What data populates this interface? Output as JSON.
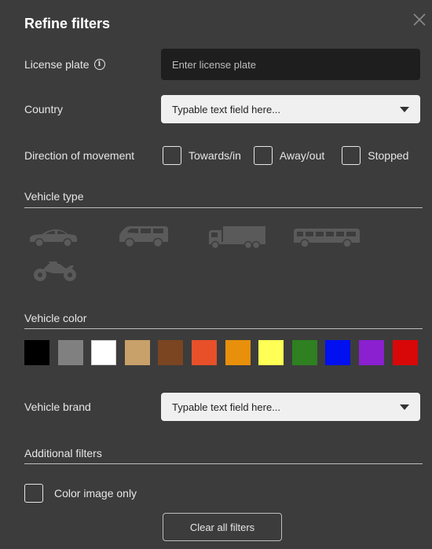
{
  "title": "Refine filters",
  "license_plate": {
    "label": "License plate",
    "placeholder": "Enter license plate"
  },
  "country": {
    "label": "Country",
    "value": "Typable text field here..."
  },
  "direction": {
    "label": "Direction of movement",
    "options": [
      "Towards/in",
      "Away/out",
      "Stopped"
    ]
  },
  "vehicle_type": {
    "title": "Vehicle type",
    "icons": [
      "car-icon",
      "van-icon",
      "truck-icon",
      "bus-icon",
      "motorcycle-icon"
    ]
  },
  "vehicle_color": {
    "title": "Vehicle color",
    "colors": [
      "#000000",
      "#808080",
      "#ffffff",
      "#c8a06a",
      "#7a4520",
      "#e8502a",
      "#e8900c",
      "#ffff55",
      "#2e8020",
      "#0010f0",
      "#8a20d0",
      "#d80808"
    ]
  },
  "vehicle_brand": {
    "label": "Vehicle brand",
    "value": "Typable text field here..."
  },
  "additional_filters": {
    "title": "Additional filters",
    "color_image_only": "Color image only"
  },
  "clear_button": "Clear all filters",
  "accent_colors": {
    "background": "#3c3c3c",
    "input_dark": "#1e1e1e",
    "dropdown_bg": "#f0f0f0",
    "icon_gray": "#5a5a5a"
  }
}
